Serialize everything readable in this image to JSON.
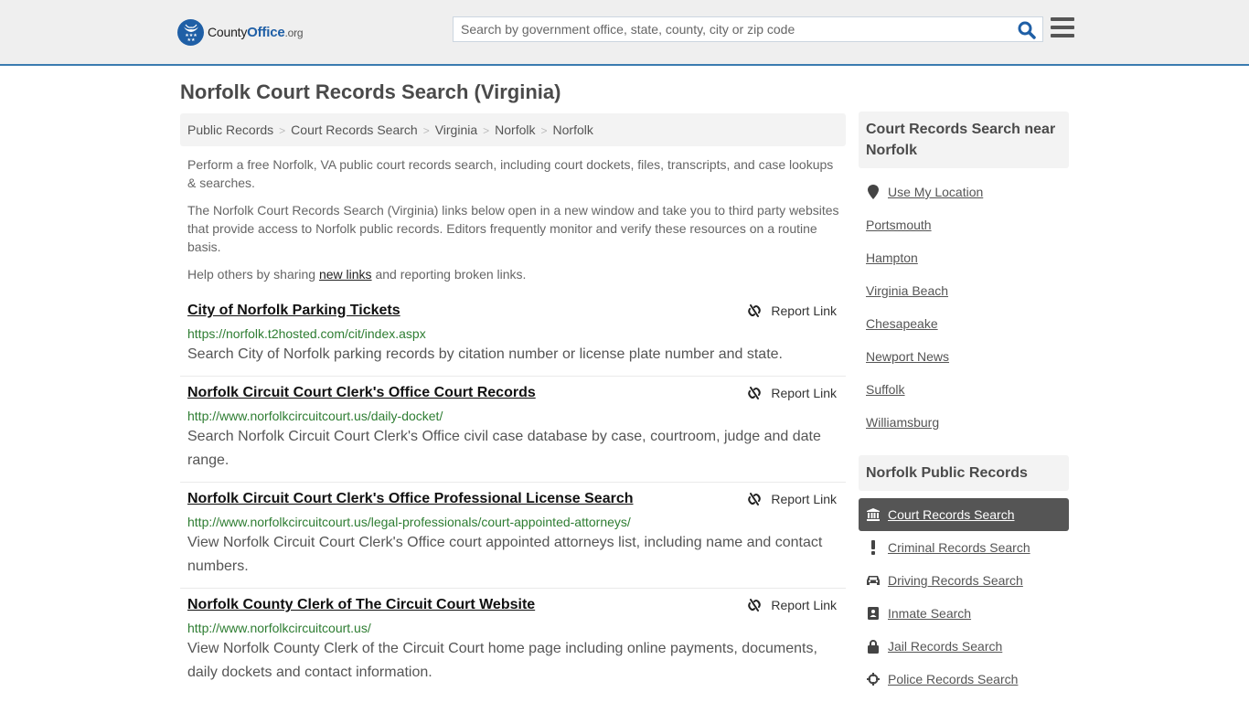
{
  "header": {
    "logo": {
      "county": "County",
      "office": "Office",
      "org": ".org"
    },
    "search_placeholder": "Search by government office, state, county, city or zip code",
    "search_value": ""
  },
  "page": {
    "title": "Norfolk Court Records Search (Virginia)"
  },
  "breadcrumb": [
    "Public Records",
    "Court Records Search",
    "Virginia",
    "Norfolk",
    "Norfolk"
  ],
  "intro": {
    "p1": "Perform a free Norfolk, VA public court records search, including court dockets, files, transcripts, and case lookups & searches.",
    "p2": "The Norfolk Court Records Search (Virginia) links below open in a new window and take you to third party websites that provide access to Norfolk public records. Editors frequently monitor and verify these resources on a routine basis.",
    "p3_before": "Help others by sharing ",
    "p3_link": "new links",
    "p3_after": " and reporting broken links."
  },
  "report_label": "Report Link",
  "results": [
    {
      "title": "City of Norfolk Parking Tickets",
      "url": "https://norfolk.t2hosted.com/cit/index.aspx",
      "desc": "Search City of Norfolk parking records by citation number or license plate number and state."
    },
    {
      "title": "Norfolk Circuit Court Clerk's Office Court Records",
      "url": "http://www.norfolkcircuitcourt.us/daily-docket/",
      "desc": "Search Norfolk Circuit Court Clerk's Office civil case database by case, courtroom, judge and date range."
    },
    {
      "title": "Norfolk Circuit Court Clerk's Office Professional License Search",
      "url": "http://www.norfolkcircuitcourt.us/legal-professionals/court-appointed-attorneys/",
      "desc": "View Norfolk Circuit Court Clerk's Office court appointed attorneys list, including name and contact numbers."
    },
    {
      "title": "Norfolk County Clerk of The Circuit Court Website",
      "url": "http://www.norfolkcircuitcourt.us/",
      "desc": "View Norfolk County Clerk of the Circuit Court home page including online payments, documents, daily dockets and contact information."
    }
  ],
  "sidebar": {
    "nearby_title": "Court Records Search near Norfolk",
    "use_location": "Use My Location",
    "nearby": [
      "Portsmouth",
      "Hampton",
      "Virginia Beach",
      "Chesapeake",
      "Newport News",
      "Suffolk",
      "Williamsburg"
    ],
    "records_title": "Norfolk Public Records",
    "records": [
      {
        "label": "Court Records Search",
        "icon": "courthouse-icon",
        "active": true
      },
      {
        "label": "Criminal Records Search",
        "icon": "exclamation-icon",
        "active": false
      },
      {
        "label": "Driving Records Search",
        "icon": "car-icon",
        "active": false
      },
      {
        "label": "Inmate Search",
        "icon": "id-badge-icon",
        "active": false
      },
      {
        "label": "Jail Records Search",
        "icon": "lock-icon",
        "active": false
      },
      {
        "label": "Police Records Search",
        "icon": "crosshairs-icon",
        "active": false
      }
    ]
  },
  "colors": {
    "brand_blue": "#1f5fa6",
    "header_border": "#3a7bb0",
    "url_green": "#2e7d32",
    "active_item_bg": "#555555"
  }
}
